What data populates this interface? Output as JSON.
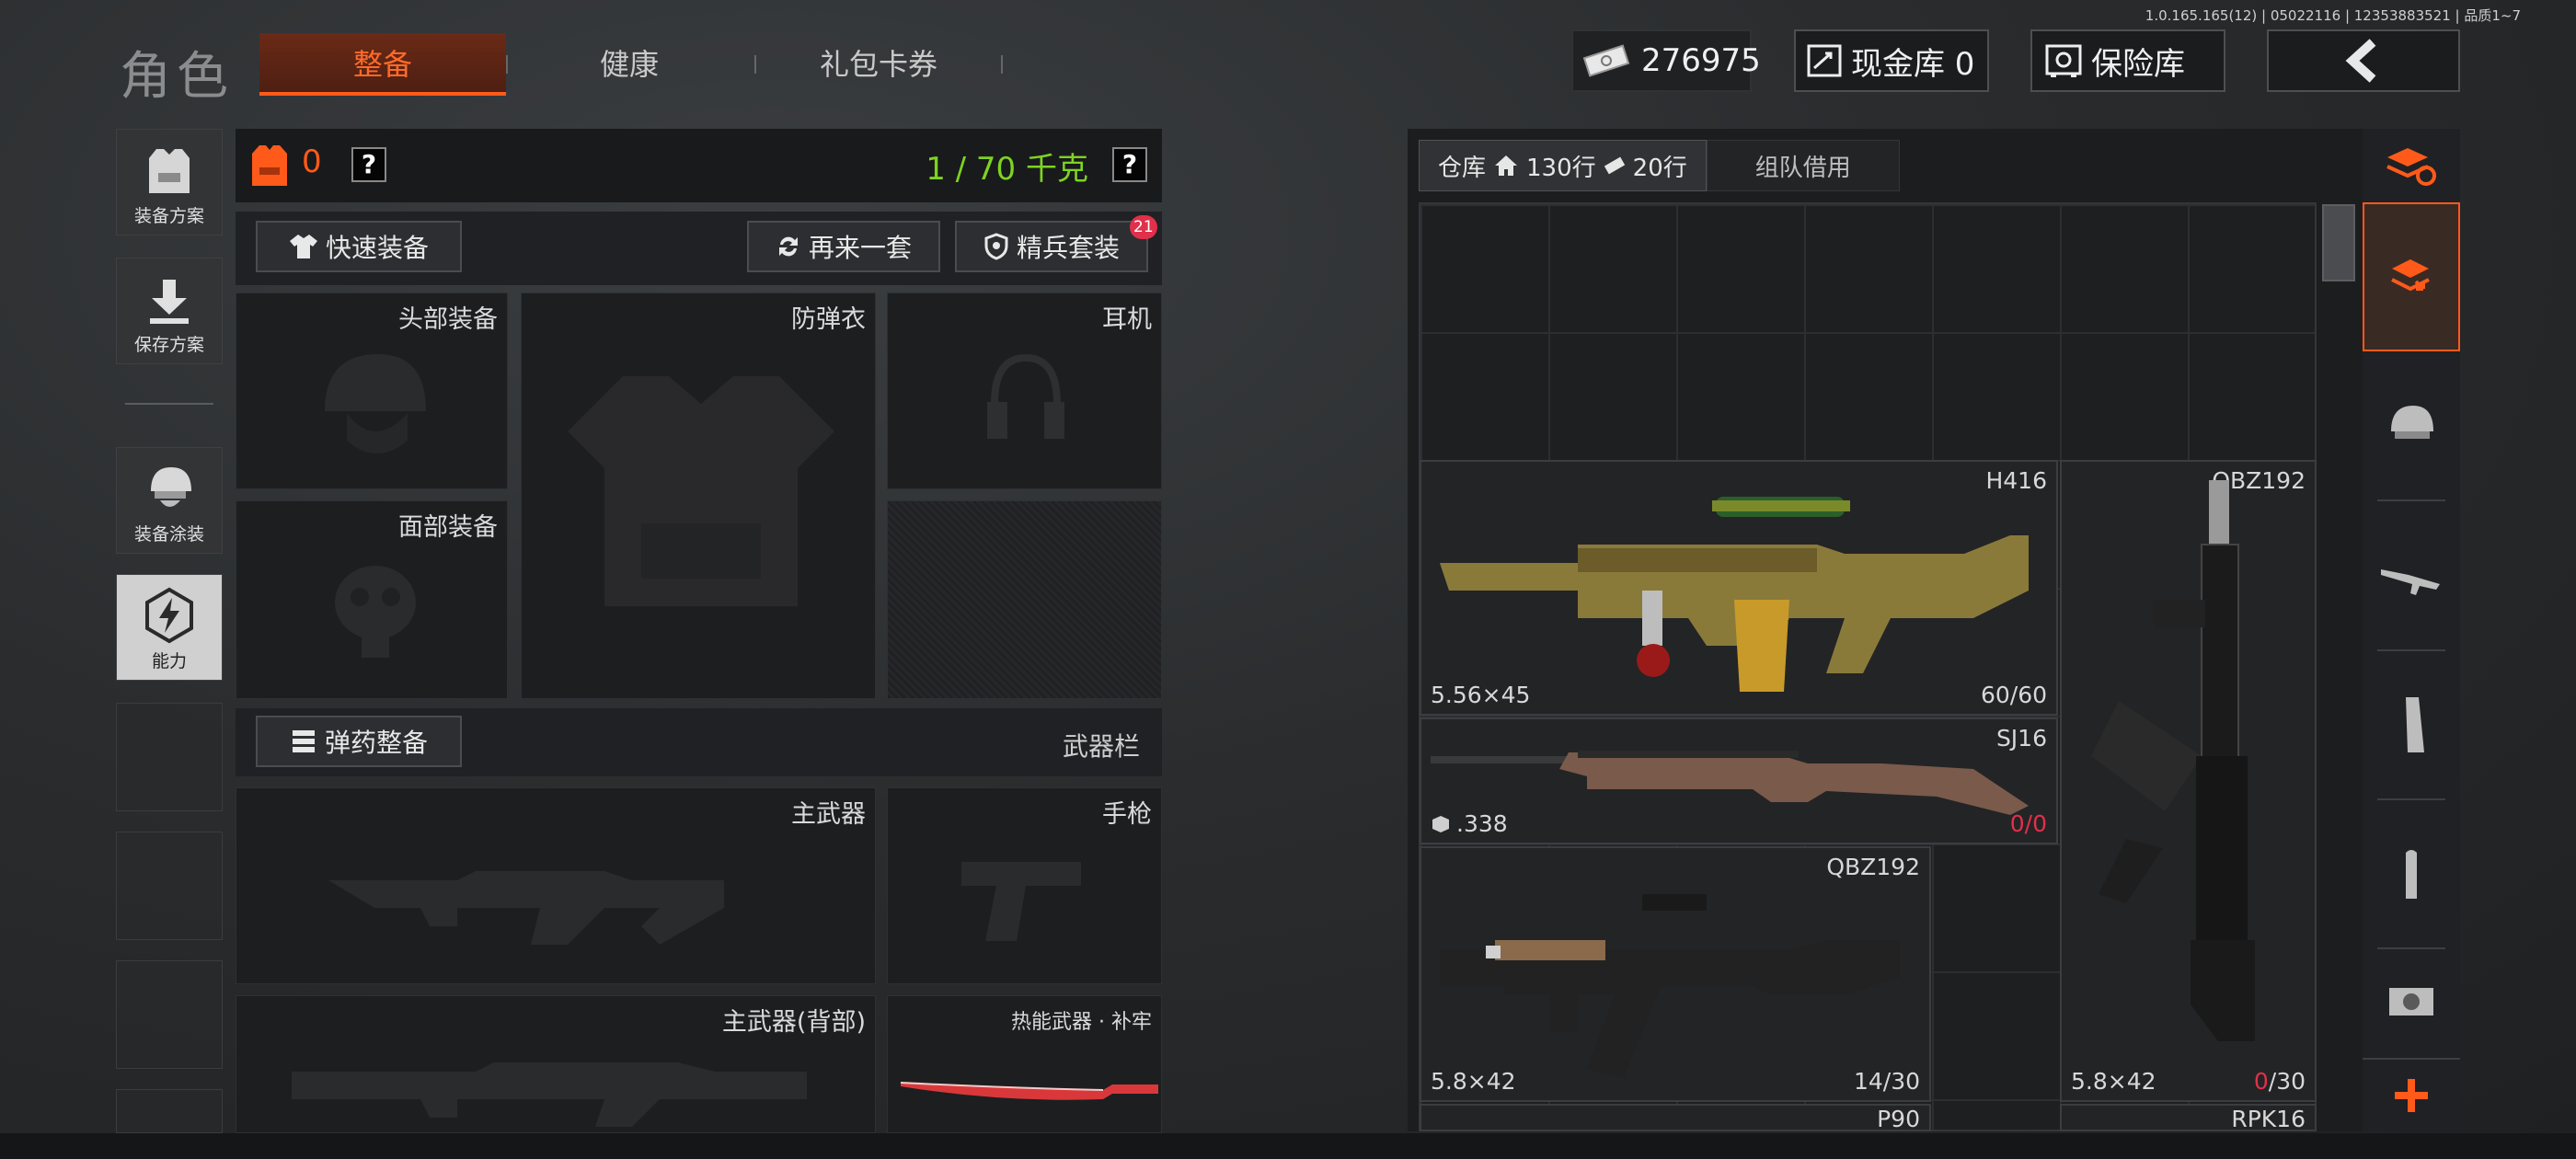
{
  "header": {
    "title": "角色",
    "tabs": [
      {
        "label": "整备",
        "active": true
      },
      {
        "label": "健康",
        "active": false
      },
      {
        "label": "礼包卡券",
        "active": false
      }
    ],
    "version": "1.0.165.165(12) | 05022116 | 12353883521 | 品质1~7",
    "money": "276975",
    "cash_vault": "现金库 0",
    "safe_box": "保险库"
  },
  "sidebar": {
    "items": [
      {
        "label": "装备方案",
        "icon": "vest-plan-icon"
      },
      {
        "label": "保存方案",
        "icon": "download-icon"
      },
      {
        "label": "装备涂装",
        "icon": "helmet-skin-icon"
      },
      {
        "label": "能力",
        "icon": "lightning-icon",
        "active": true
      }
    ]
  },
  "equip": {
    "armor_count": "0",
    "weight": "1 / 70 千克",
    "quick_equip": "快速装备",
    "reroll": "再来一套",
    "elite_set": "精兵套装",
    "elite_badge": "21",
    "slots": {
      "head": "头部装备",
      "vest": "防弹衣",
      "ear": "耳机",
      "face": "面部装备",
      "ammo_btn": "弹药整备",
      "weapon_bar": "武器栏",
      "primary": "主武器",
      "pistol": "手枪",
      "primary_back": "主武器(背部)",
      "melee": "热能武器 · 补牢"
    }
  },
  "warehouse": {
    "tab_label": "仓库",
    "rows_a": "130行",
    "rows_b": "20行",
    "team_tab": "组队借用",
    "items": [
      {
        "name": "H416",
        "caliber": "5.56×45",
        "ammo": "60/60"
      },
      {
        "name": "QBZ192",
        "caliber": "5.8×42",
        "ammo_cur": "0",
        "ammo_max": "/30"
      },
      {
        "name": "SJ16",
        "caliber": ".338",
        "ammo_cur": "0",
        "ammo_max": "/0"
      },
      {
        "name": "QBZ192",
        "caliber": "5.8×42",
        "ammo": "14/30"
      },
      {
        "name": "P90"
      },
      {
        "name": "RPK16"
      }
    ]
  },
  "colors": {
    "accent": "#ff5a1a",
    "weight_green": "#7ed321",
    "ammo_empty": "#e0304a"
  }
}
